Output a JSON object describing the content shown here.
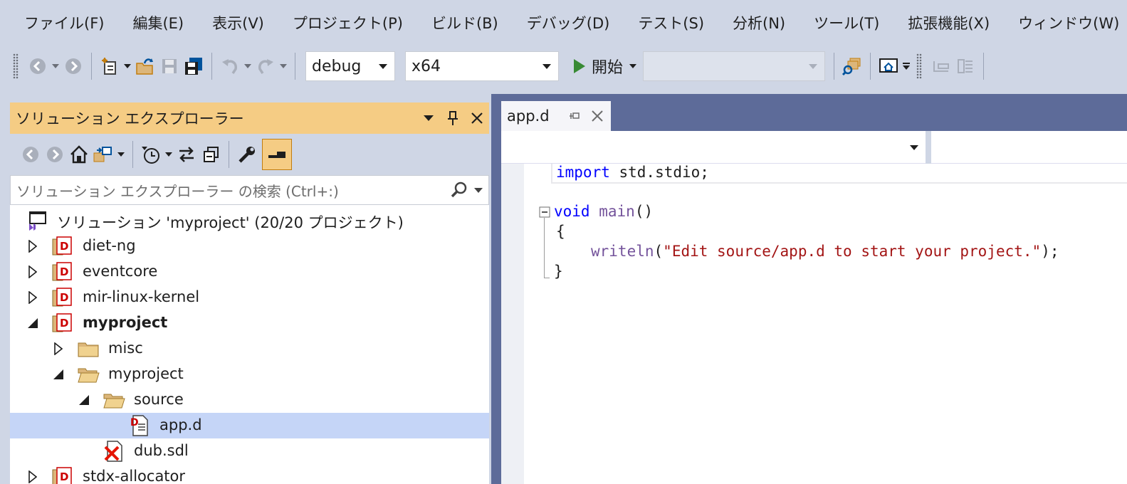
{
  "menu": [
    "ファイル(F)",
    "編集(E)",
    "表示(V)",
    "プロジェクト(P)",
    "ビルド(B)",
    "デバッグ(D)",
    "テスト(S)",
    "分析(N)",
    "ツール(T)",
    "拡張機能(X)",
    "ウィンドウ(W)"
  ],
  "toolbar": {
    "config": "debug",
    "platform": "x64",
    "start_label": "開始"
  },
  "solution_explorer": {
    "title": "ソリューション エクスプローラー",
    "search_placeholder": "ソリューション エクスプローラー の検索 (Ctrl+:)",
    "tree": [
      {
        "label": "ソリューション 'myproject' (20/20 プロジェクト)",
        "level": 0,
        "type": "solution",
        "expander": "none"
      },
      {
        "label": "diet-ng",
        "level": 1,
        "type": "project",
        "expander": "collapsed"
      },
      {
        "label": "eventcore",
        "level": 1,
        "type": "project",
        "expander": "collapsed"
      },
      {
        "label": "mir-linux-kernel",
        "level": 1,
        "type": "project",
        "expander": "collapsed"
      },
      {
        "label": "myproject",
        "level": 1,
        "type": "project",
        "expander": "expanded",
        "bold": true
      },
      {
        "label": "misc",
        "level": 2,
        "type": "folder",
        "expander": "collapsed"
      },
      {
        "label": "myproject",
        "level": 2,
        "type": "folder-open",
        "expander": "expanded"
      },
      {
        "label": "source",
        "level": 3,
        "type": "folder-open",
        "expander": "expanded"
      },
      {
        "label": "app.d",
        "level": 4,
        "type": "dfile",
        "expander": "none",
        "selected": true
      },
      {
        "label": "dub.sdl",
        "level": 3,
        "type": "excluded",
        "expander": "none"
      },
      {
        "label": "stdx-allocator",
        "level": 1,
        "type": "project",
        "expander": "collapsed"
      }
    ]
  },
  "editor": {
    "tab": "app.d",
    "code": {
      "import_kw": "import",
      "import_rest": " std.stdio;",
      "void_kw": "void",
      "main_fn": "main",
      "main_paren": "()",
      "open_brace": "{",
      "writeln_fn": "writeln",
      "paren_open": "(",
      "string": "\"Edit source/app.d to start your project.\"",
      "call_end": ");",
      "close_brace": "}"
    }
  },
  "colors": {
    "chrome": "#cfd6e5",
    "title_active": "#f5cc84",
    "editor_frame": "#5d6b99",
    "selection": "#c5d5f7",
    "keyword": "#0000ff",
    "function": "#74539b",
    "string": "#a31515"
  }
}
